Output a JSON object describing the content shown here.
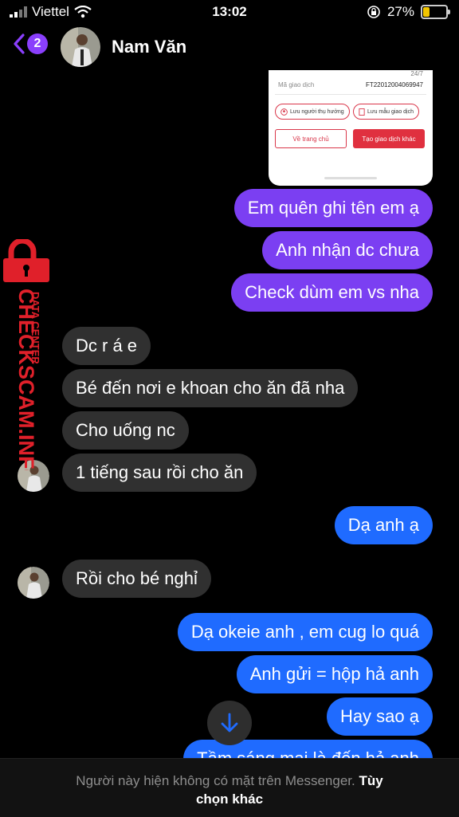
{
  "status_bar": {
    "carrier": "Viettel",
    "time": "13:02",
    "battery_percent": "27%",
    "battery_level": 0.27,
    "signal_icon": "signal-bars-icon",
    "wifi_icon": "wifi-icon"
  },
  "header": {
    "back_badge": "2",
    "contact_name": "Nam Văn"
  },
  "shared_screenshot": {
    "service_tag": "24/7",
    "transaction_label": "Mã giao dịch",
    "transaction_id": "FT22012004069947",
    "save_recipient": "Lưu người thụ hưởng",
    "save_template": "Lưu mẫu giao dịch",
    "home_button": "Về trang chủ",
    "new_transaction_button": "Tạo giao dịch khác"
  },
  "messages": [
    {
      "side": "sent",
      "text": "Em quên ghi tên em ạ"
    },
    {
      "side": "sent",
      "text": "Anh nhận dc chưa"
    },
    {
      "side": "sent",
      "text": "Check dùm em vs nha"
    },
    {
      "side": "received",
      "text": "Dc r á e"
    },
    {
      "side": "received",
      "text": "Bé đến nơi e khoan cho ăn đã nha"
    },
    {
      "side": "received",
      "text": "Cho uống nc"
    },
    {
      "side": "received",
      "text": "1 tiếng sau rồi cho ăn"
    },
    {
      "side": "sent",
      "text": "Dạ anh ạ"
    },
    {
      "side": "received",
      "text": "Rồi cho bé nghỉ"
    },
    {
      "side": "sent",
      "text": "Dạ okeie anh , em cug lo quá"
    },
    {
      "side": "sent",
      "text": "Anh gửi = hộp hả anh"
    },
    {
      "side": "sent",
      "text": "Hay sao ạ"
    },
    {
      "side": "sent",
      "text": "Tầm sáng mai là đến hả anh"
    }
  ],
  "watermark": {
    "line1": "DATA CENTER",
    "line2": "CHECKSCAM.INFO"
  },
  "footer": {
    "notice": "Người này hiện không có mặt trên Messenger.",
    "action_part1": "Tùy",
    "action_part2": "chọn khác"
  },
  "colors": {
    "sent_purple": "#7b3ff2",
    "sent_blue": "#1f6bff",
    "received": "#303030",
    "accent": "#8a3ffc"
  }
}
